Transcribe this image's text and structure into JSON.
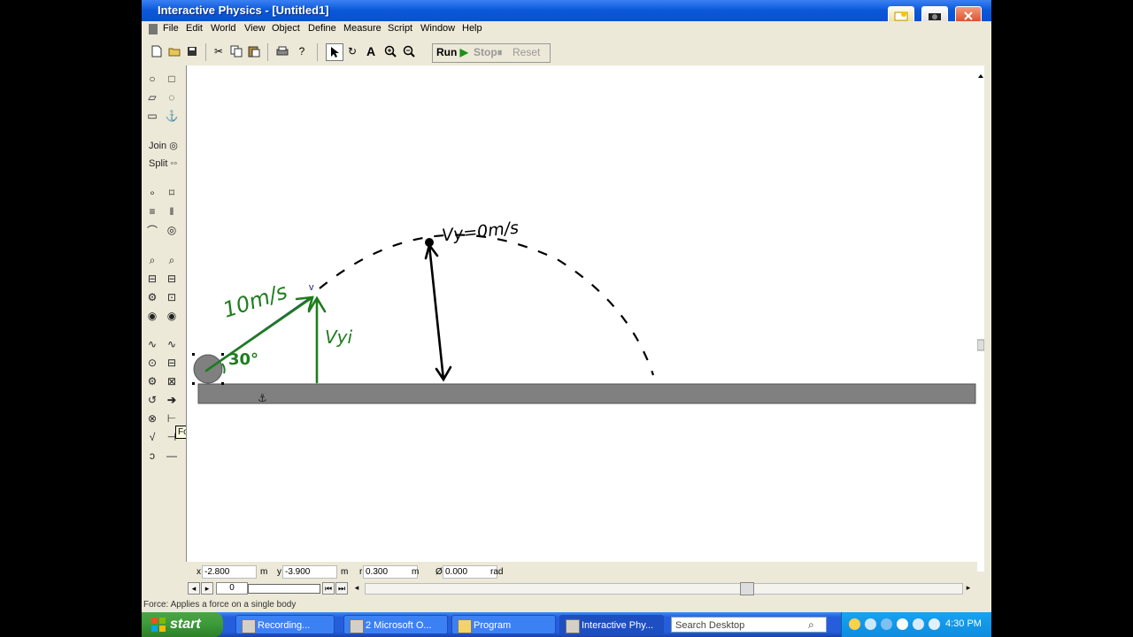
{
  "window": {
    "title": "Interactive Physics - [Untitled1]"
  },
  "menu": [
    "File",
    "Edit",
    "World",
    "View",
    "Object",
    "Define",
    "Measure",
    "Script",
    "Window",
    "Help"
  ],
  "toolbar": {
    "run_label": "Run",
    "stop_label": "Stop",
    "reset_label": "Reset"
  },
  "palette": {
    "join_label": "Join",
    "split_label": "Split",
    "tooltip": "Force"
  },
  "canvas": {
    "labels": {
      "velocity_initial": "10m/s",
      "angle": "30°",
      "v_yi": "Vyi",
      "v_top": "Vy=0m/s",
      "v_marker": "v"
    }
  },
  "coords": {
    "x_label": "x",
    "x_value": "-2.800",
    "x_unit": "m",
    "y_label": "y",
    "y_value": "-3.900",
    "y_unit": "m",
    "r_label": "r",
    "r_value": "0.300",
    "r_unit": "m",
    "phi_label": "Ø",
    "phi_value": "0.000",
    "phi_unit": "rad"
  },
  "frame": {
    "value": "0"
  },
  "status": {
    "text": "Force:  Applies a force on a single body"
  },
  "taskbar": {
    "start_label": "start",
    "tasks": [
      "Recording...",
      "2 Microsoft O...",
      "Program",
      "Interactive Phy..."
    ],
    "search_placeholder": "Search Desktop",
    "clock": "4:30 PM"
  },
  "colors": {
    "xp_blue": "#245edb",
    "start_green": "#3c9a3a",
    "annotation_green": "#1e7d1e",
    "ground_gray": "#808080"
  }
}
